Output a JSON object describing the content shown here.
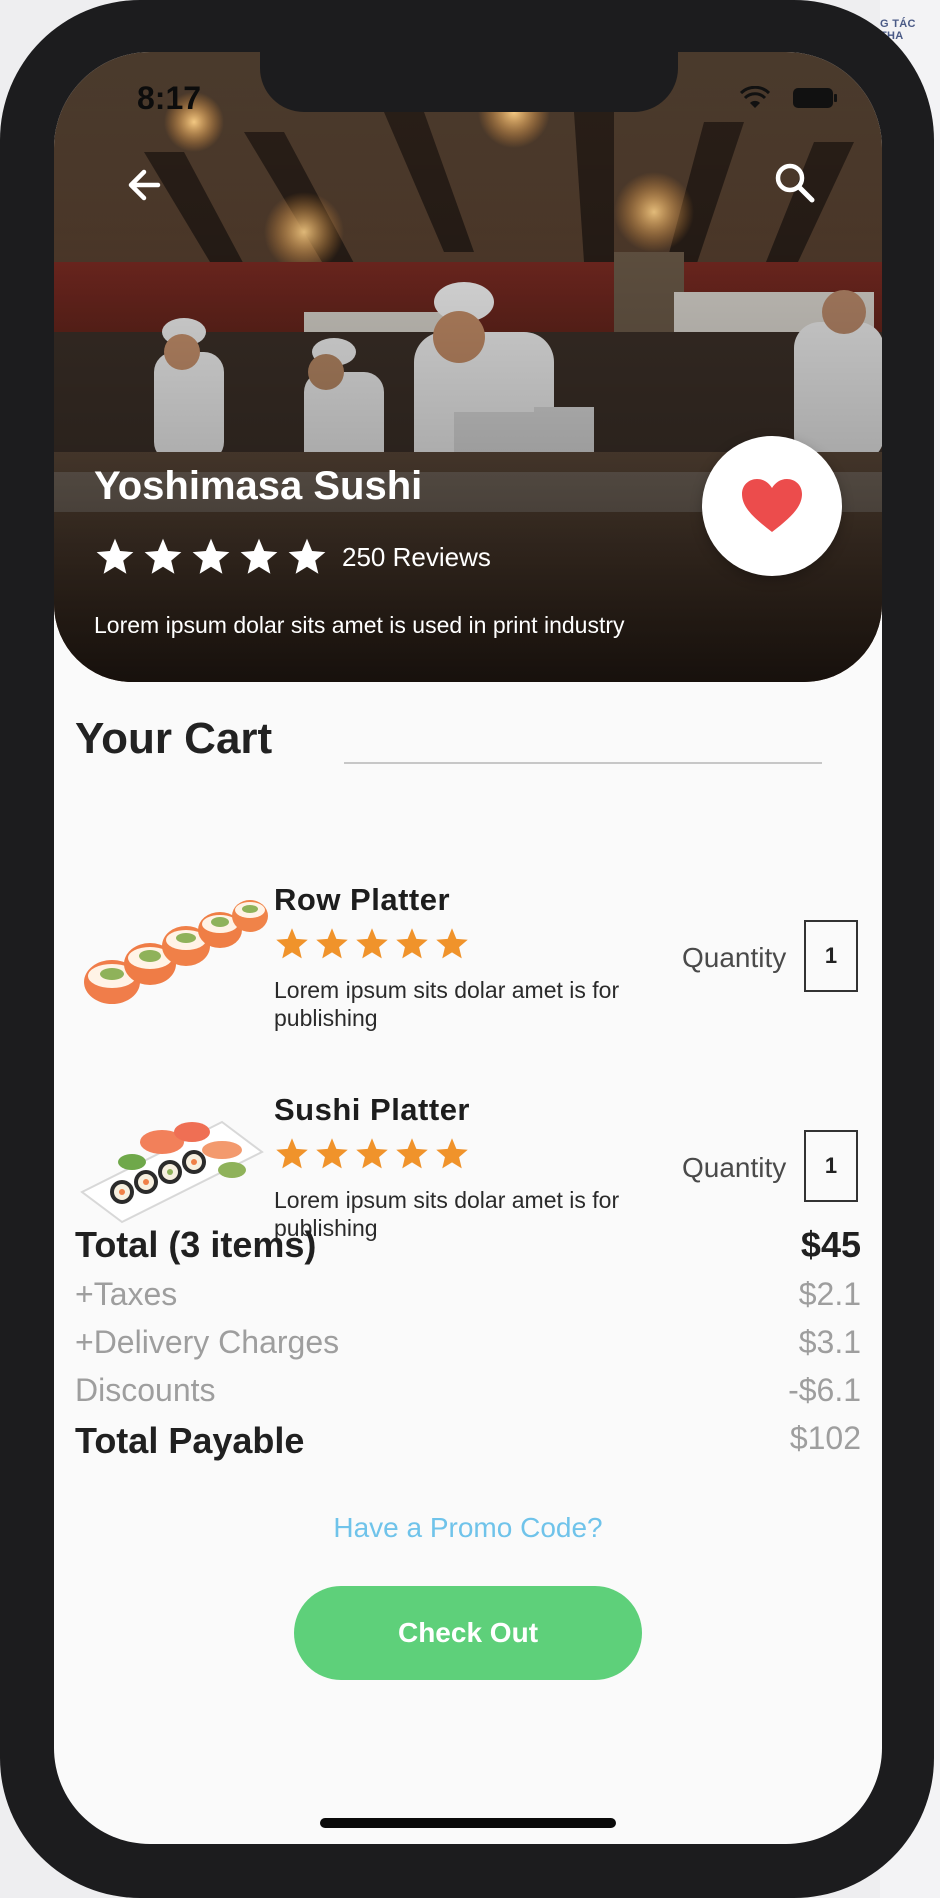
{
  "status_bar": {
    "time": "8:17"
  },
  "background_app": {
    "text": "G TÁC THA"
  },
  "restaurant": {
    "name": "Yoshimasa Sushi",
    "rating": 5,
    "reviews": "250 Reviews",
    "description": "Lorem ipsum dolar sits amet is used in print industry"
  },
  "cart": {
    "title": "Your Cart",
    "items": [
      {
        "name": "Row Platter",
        "rating": 5,
        "description": "Lorem ipsum sits dolar amet is for publishing",
        "quantity_label": "Quantity",
        "quantity": "1"
      },
      {
        "name": "Sushi Platter",
        "rating": 5,
        "description": "Lorem ipsum sits dolar amet is for publishing",
        "quantity_label": "Quantity",
        "quantity": "1"
      }
    ]
  },
  "summary": {
    "total_label": "Total (3 items)",
    "total_value": "$45",
    "taxes_label": "+Taxes",
    "taxes_value": "$2.1",
    "delivery_label": "+Delivery Charges",
    "delivery_value": "$3.1",
    "discounts_label": "Discounts",
    "discounts_value": "-$6.1",
    "payable_label": "Total Payable",
    "payable_value": "$102"
  },
  "promo_link": "Have a Promo Code?",
  "checkout_button": "Check Out",
  "colors": {
    "accent_green": "#5ed07a",
    "star_orange": "#f0932b",
    "heart_red": "#ec4c4c",
    "promo_blue": "#6fc3ea"
  }
}
